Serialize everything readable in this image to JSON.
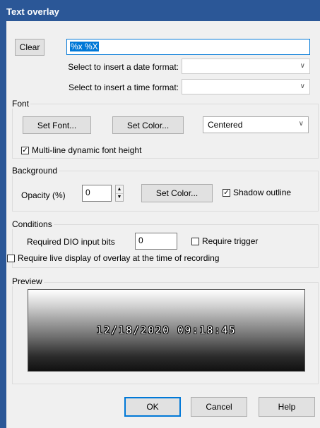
{
  "window": {
    "title": "Text overlay"
  },
  "format": {
    "clear_label": "Clear",
    "text_value": "%x %X",
    "date_format_label": "Select to insert a date format:",
    "date_format_value": "",
    "time_format_label": "Select to insert a time format:",
    "time_format_value": ""
  },
  "font": {
    "group_title": "Font",
    "set_font_label": "Set Font...",
    "set_color_label": "Set Color...",
    "alignment_value": "Centered",
    "multiline_label": "Multi-line dynamic font height",
    "multiline_checked": true
  },
  "background": {
    "group_title": "Background",
    "opacity_label": "Opacity (%)",
    "opacity_value": "0",
    "set_color_label": "Set Color...",
    "shadow_label": "Shadow outline",
    "shadow_checked": true
  },
  "conditions": {
    "group_title": "Conditions",
    "dio_label": "Required DIO input bits",
    "dio_value": "0",
    "require_trigger_label": "Require trigger",
    "require_trigger_checked": false,
    "require_live_label": "Require live display of overlay at the time of recording",
    "require_live_checked": false
  },
  "preview": {
    "group_title": "Preview",
    "text": "12/18/2020 09:18:45"
  },
  "footer": {
    "ok_label": "OK",
    "cancel_label": "Cancel",
    "help_label": "Help"
  },
  "icons": {
    "check": "checkmark-icon",
    "dropdown": "chevron-down-icon",
    "spin_up": "spin-up-icon",
    "spin_down": "spin-down-icon"
  }
}
